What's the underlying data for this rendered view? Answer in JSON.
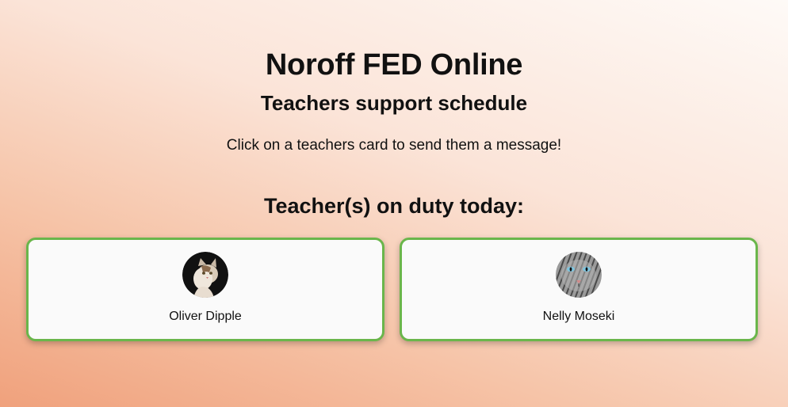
{
  "header": {
    "title": "Noroff FED Online",
    "subtitle": "Teachers support schedule",
    "intro": "Click on a teachers card to send them a message!"
  },
  "duty": {
    "heading": "Teacher(s) on duty today:",
    "teachers": [
      {
        "name": "Oliver Dipple",
        "avatar_icon": "cat-avatar-tabby"
      },
      {
        "name": "Nelly Moseki",
        "avatar_icon": "cat-avatar-grey"
      }
    ]
  },
  "colors": {
    "card_border": "#6ab64b",
    "card_background": "#fafafa"
  }
}
